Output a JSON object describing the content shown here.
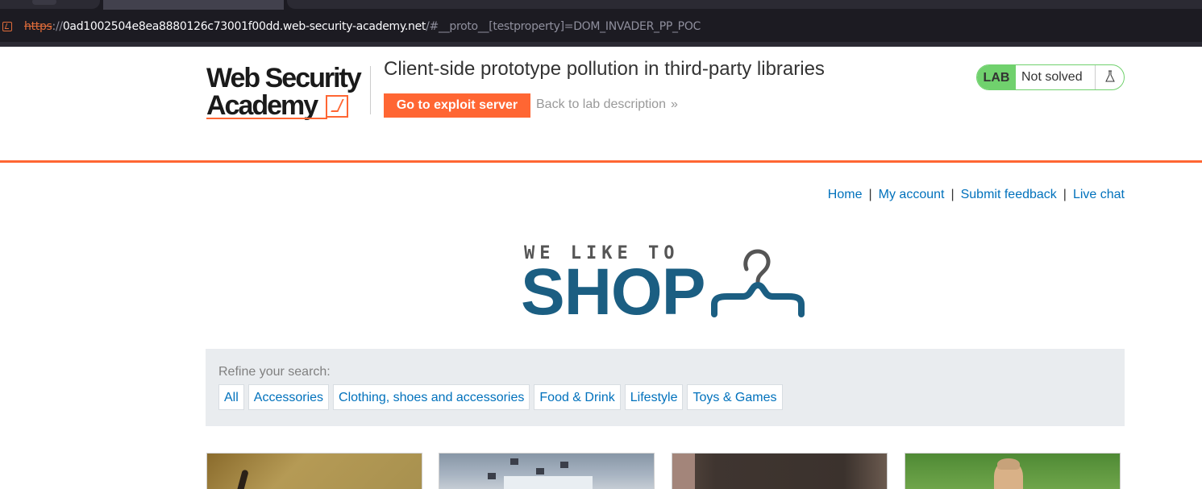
{
  "browser": {
    "url_scheme": "https",
    "url_sep": "://",
    "url_host": "0ad1002504e8ea8880126c73001f00dd.web-security-academy.net",
    "url_path": "/#__proto__[testproperty]=DOM_INVADER_PP_POC"
  },
  "academy": {
    "logo_line1": "Web Security",
    "logo_line2": "Academy",
    "lab_title": "Client-side prototype pollution in third-party libraries",
    "exploit_button": "Go to exploit server",
    "back_link": "Back to lab description",
    "back_chevron": "»",
    "lab_badge": "LAB",
    "lab_status": "Not solved",
    "accent_color": "#ff6633",
    "status_color": "#70d16d"
  },
  "nav": {
    "home": "Home",
    "my_account": "My account",
    "submit_feedback": "Submit feedback",
    "live_chat": "Live chat",
    "separator": "|"
  },
  "shop": {
    "tagline": "WE LIKE TO",
    "name": "SHOP",
    "brand_color": "#1b5e82"
  },
  "filter": {
    "label": "Refine your search:",
    "categories": [
      "All",
      "Accessories",
      "Clothing, shoes and accessories",
      "Food & Drink",
      "Lifestyle",
      "Toys & Games"
    ]
  }
}
